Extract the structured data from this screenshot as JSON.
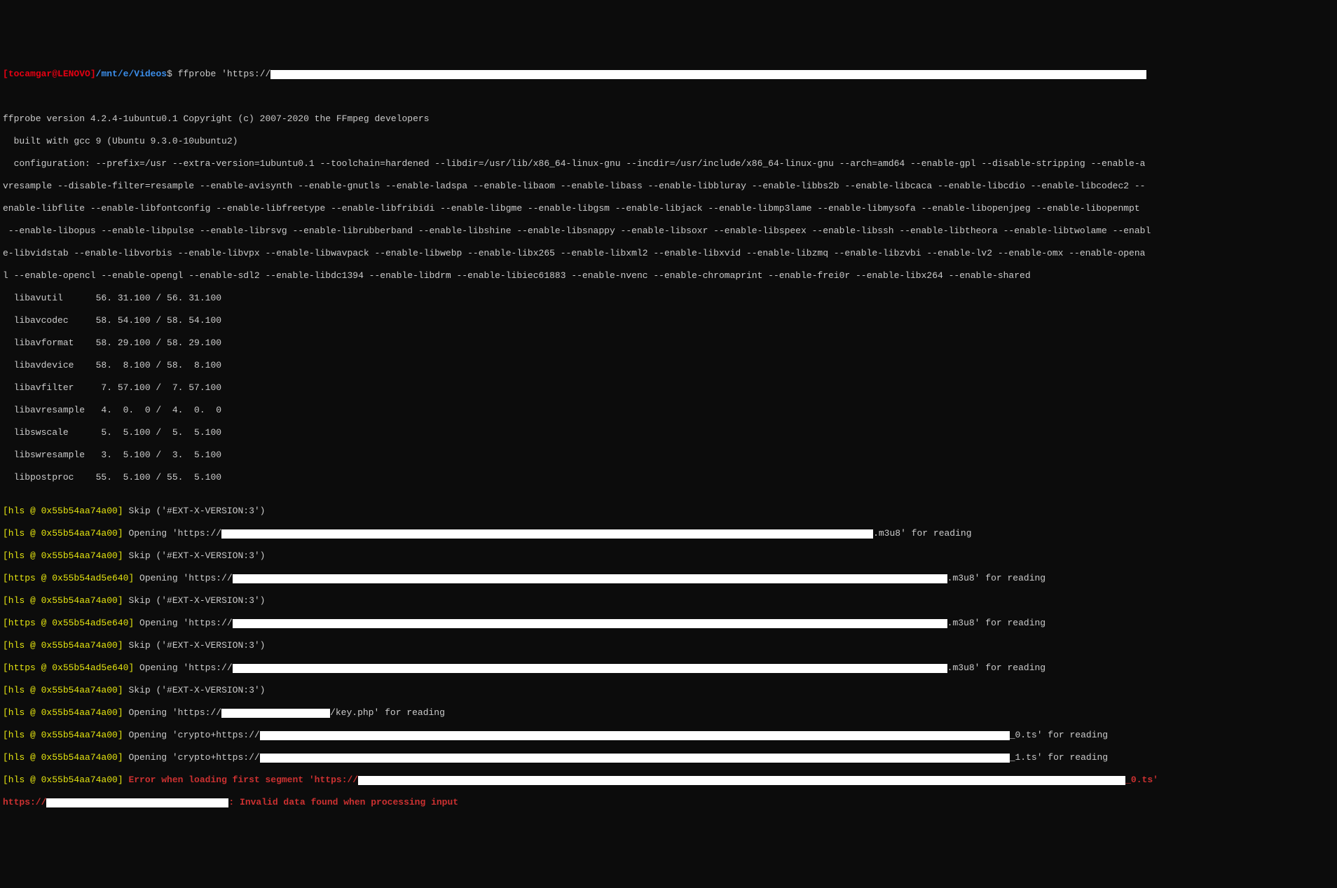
{
  "prompt": {
    "open_bracket": "[",
    "user_host": "tocamgar@LENOVO",
    "close_bracket": "]",
    "path": "/mnt/e/Videos",
    "dollar": "$",
    "command": "ffprobe 'https://"
  },
  "output": {
    "version_line": "ffprobe version 4.2.4-1ubuntu0.1 Copyright (c) 2007-2020 the FFmpeg developers",
    "built_line": "  built with gcc 9 (Ubuntu 9.3.0-10ubuntu2)",
    "config_l1": "  configuration: --prefix=/usr --extra-version=1ubuntu0.1 --toolchain=hardened --libdir=/usr/lib/x86_64-linux-gnu --incdir=/usr/include/x86_64-linux-gnu --arch=amd64 --enable-gpl --disable-stripping --enable-a",
    "config_l2": "vresample --disable-filter=resample --enable-avisynth --enable-gnutls --enable-ladspa --enable-libaom --enable-libass --enable-libbluray --enable-libbs2b --enable-libcaca --enable-libcdio --enable-libcodec2 --",
    "config_l3": "enable-libflite --enable-libfontconfig --enable-libfreetype --enable-libfribidi --enable-libgme --enable-libgsm --enable-libjack --enable-libmp3lame --enable-libmysofa --enable-libopenjpeg --enable-libopenmpt",
    "config_l4": " --enable-libopus --enable-libpulse --enable-librsvg --enable-librubberband --enable-libshine --enable-libsnappy --enable-libsoxr --enable-libspeex --enable-libssh --enable-libtheora --enable-libtwolame --enabl",
    "config_l5": "e-libvidstab --enable-libvorbis --enable-libvpx --enable-libwavpack --enable-libwebp --enable-libx265 --enable-libxml2 --enable-libxvid --enable-libzmq --enable-libzvbi --enable-lv2 --enable-omx --enable-opena",
    "config_l6": "l --enable-opencl --enable-opengl --enable-sdl2 --enable-libdc1394 --enable-libdrm --enable-libiec61883 --enable-nvenc --enable-chromaprint --enable-frei0r --enable-libx264 --enable-shared",
    "libs": [
      "  libavutil      56. 31.100 / 56. 31.100",
      "  libavcodec     58. 54.100 / 58. 54.100",
      "  libavformat    58. 29.100 / 58. 29.100",
      "  libavdevice    58.  8.100 / 58.  8.100",
      "  libavfilter     7. 57.100 /  7. 57.100",
      "  libavresample   4.  0.  0 /  4.  0.  0",
      "  libswscale      5.  5.100 /  5.  5.100",
      "  libswresample   3.  5.100 /  3.  5.100",
      "  libpostproc    55.  5.100 / 55.  5.100"
    ],
    "hls_prefix": "[hls @ 0x55b54aa74a00]",
    "https_prefix": "[https @ 0x55b54ad5e640]",
    "skip_msg": " Skip ('#EXT-X-VERSION:3')",
    "opening_https": " Opening 'https://",
    "m3u8_suffix": ".m3u8' for reading",
    "key_suffix": "/key.php' for reading",
    "opening_crypto": " Opening 'crypto+https://",
    "ts0_suffix": "_0.ts' for reading",
    "ts1_suffix": "_1.ts' for reading",
    "err_seg_pre": " Error when loading first segment 'https://",
    "err_seg_suf": "_0.ts'",
    "https_err_pre": "https://",
    "invalid_data": ": Invalid data found when processing input"
  }
}
